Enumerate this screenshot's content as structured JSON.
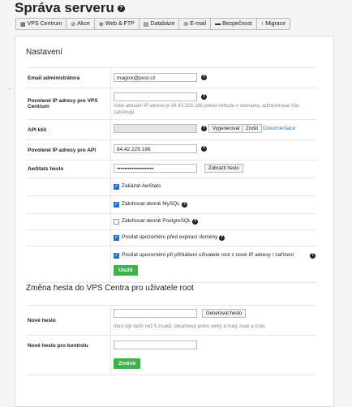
{
  "page_title": "Správa serveru",
  "tabs": [
    {
      "icon": "▦",
      "label": "VPS Centrum"
    },
    {
      "icon": "⊘",
      "label": "Akce"
    },
    {
      "icon": "⊕",
      "label": "Web & FTP"
    },
    {
      "icon": "▤",
      "label": "Databáze"
    },
    {
      "icon": "✉",
      "label": "E-mail"
    },
    {
      "icon": "▬",
      "label": "Bezpečnost"
    },
    {
      "icon": "↑",
      "label": "Migrace"
    }
  ],
  "settings": {
    "title": "Nastavení",
    "admin_email_label": "Email administrátora",
    "admin_email_value": "magixx@post.cz",
    "allowed_ip_vps_label": "Povolené IP adresy pro VPS Centrum",
    "allowed_ip_vps_value": "",
    "allowed_ip_vps_hint": "Vaše aktuální IP adresa je 84.42.229.186 pokud nebude v seznamu, administrace Vás zablokuje.",
    "api_key_label": "API klíč",
    "api_key_value": "",
    "generate_button": "Vygenerovat",
    "cancel_button": "Zrušit",
    "documentation_link": "Dokumentace",
    "allowed_ip_api_label": "Povolené IP adresy pro API",
    "allowed_ip_api_value": "84.42.229.186",
    "awstats_label": "AwStats heslo",
    "awstats_value": "••••••••••••••••••••",
    "show_password_button": "Zobrazit heslo",
    "checkboxes": [
      {
        "label": "Zakázat AwStats",
        "checked": true,
        "help": false
      },
      {
        "label": "Zálohovat denně MySQL",
        "checked": true,
        "help": true
      },
      {
        "label": "Zálohovat denně PostgreSQL",
        "checked": false,
        "help": true
      },
      {
        "label": "Posílat upozornění před expirací domény",
        "checked": true,
        "help": true
      },
      {
        "label": "Posílat upozornění při přihlášení uživatele root z nové IP adresy / zařízení",
        "checked": true,
        "help": true
      }
    ],
    "save_button": "Uložit"
  },
  "password": {
    "title": "Změna hesla do VPS Centra pro uživatele root",
    "new_label": "Nové heslo",
    "new_value": "",
    "generate_button": "Generovat heslo",
    "hint": "Musí být delší než 5 znaků, obsahovat jeden velký a malý znak a číslo.",
    "confirm_label": "Nové heslo pro kontrolu",
    "confirm_value": "",
    "change_button": "Změnit"
  }
}
